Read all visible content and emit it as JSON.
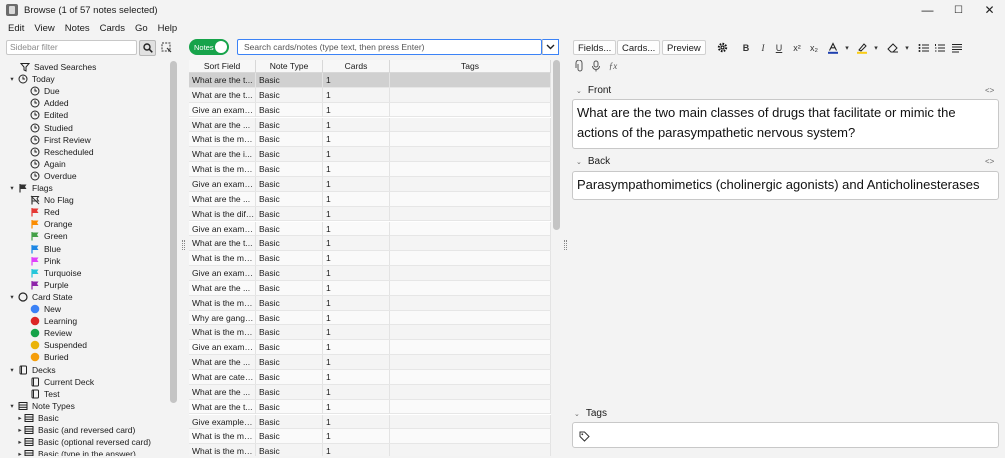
{
  "window": {
    "title": "Browse (1 of 57 notes selected)",
    "min": "—",
    "max": "☐",
    "close": "✕"
  },
  "menu": [
    "Edit",
    "View",
    "Notes",
    "Cards",
    "Go",
    "Help"
  ],
  "sidebar": {
    "filter_placeholder": "Sidebar filter",
    "items": [
      {
        "label": "Saved Searches",
        "icon": "funnel-icon",
        "level": 1,
        "arrow": ""
      },
      {
        "label": "Today",
        "icon": "clock-icon",
        "level": 1,
        "arrow": "▾"
      },
      {
        "label": "Due",
        "icon": "clock-icon",
        "level": 2,
        "arrow": ""
      },
      {
        "label": "Added",
        "icon": "clock-icon",
        "level": 2,
        "arrow": ""
      },
      {
        "label": "Edited",
        "icon": "clock-icon",
        "level": 2,
        "arrow": ""
      },
      {
        "label": "Studied",
        "icon": "clock-icon",
        "level": 2,
        "arrow": ""
      },
      {
        "label": "First Review",
        "icon": "clock-icon",
        "level": 2,
        "arrow": ""
      },
      {
        "label": "Rescheduled",
        "icon": "clock-icon",
        "level": 2,
        "arrow": ""
      },
      {
        "label": "Again",
        "icon": "clock-icon",
        "level": 2,
        "arrow": ""
      },
      {
        "label": "Overdue",
        "icon": "clock-icon",
        "level": 2,
        "arrow": ""
      },
      {
        "label": "Flags",
        "icon": "flag-icon",
        "level": 1,
        "arrow": "▾",
        "color": "#333333"
      },
      {
        "label": "No Flag",
        "icon": "no-flag-icon",
        "level": 2,
        "arrow": "",
        "color": "#333333"
      },
      {
        "label": "Red",
        "icon": "flag-icon",
        "level": 2,
        "arrow": "",
        "color": "#e53935"
      },
      {
        "label": "Orange",
        "icon": "flag-icon",
        "level": 2,
        "arrow": "",
        "color": "#fb8c00"
      },
      {
        "label": "Green",
        "icon": "flag-icon",
        "level": 2,
        "arrow": "",
        "color": "#43a047"
      },
      {
        "label": "Blue",
        "icon": "flag-icon",
        "level": 2,
        "arrow": "",
        "color": "#1e88e5"
      },
      {
        "label": "Pink",
        "icon": "flag-icon",
        "level": 2,
        "arrow": "",
        "color": "#e040fb"
      },
      {
        "label": "Turquoise",
        "icon": "flag-icon",
        "level": 2,
        "arrow": "",
        "color": "#26c6da"
      },
      {
        "label": "Purple",
        "icon": "flag-icon",
        "level": 2,
        "arrow": "",
        "color": "#8e24aa"
      },
      {
        "label": "Card State",
        "icon": "circle-outline-icon",
        "level": 1,
        "arrow": "▾"
      },
      {
        "label": "New",
        "icon": "dot-icon",
        "level": 2,
        "arrow": "",
        "color": "#3b82f6"
      },
      {
        "label": "Learning",
        "icon": "dot-icon",
        "level": 2,
        "arrow": "",
        "color": "#dc2626"
      },
      {
        "label": "Review",
        "icon": "dot-icon",
        "level": 2,
        "arrow": "",
        "color": "#16a34a"
      },
      {
        "label": "Suspended",
        "icon": "dot-icon",
        "level": 2,
        "arrow": "",
        "color": "#eab308"
      },
      {
        "label": "Buried",
        "icon": "dot-icon",
        "level": 2,
        "arrow": "",
        "color": "#f59e0b"
      },
      {
        "label": "Decks",
        "icon": "deck-icon",
        "level": 1,
        "arrow": "▾"
      },
      {
        "label": "Current Deck",
        "icon": "deck-icon",
        "level": 2,
        "arrow": ""
      },
      {
        "label": "Test",
        "icon": "deck-icon",
        "level": 2,
        "arrow": ""
      },
      {
        "label": "Note Types",
        "icon": "notetype-icon",
        "level": 1,
        "arrow": "▾"
      },
      {
        "label": "Basic",
        "icon": "notetype-icon",
        "level": 2,
        "arrow": "▸"
      },
      {
        "label": "Basic (and reversed card)",
        "icon": "notetype-icon",
        "level": 2,
        "arrow": "▸"
      },
      {
        "label": "Basic (optional reversed card)",
        "icon": "notetype-icon",
        "level": 2,
        "arrow": "▸"
      },
      {
        "label": "Basic (type in the answer)",
        "icon": "notetype-icon",
        "level": 2,
        "arrow": "▸"
      }
    ]
  },
  "search": {
    "toggle_label": "Notes",
    "placeholder": "Search cards/notes (type text, then press Enter)"
  },
  "table": {
    "columns": [
      "Sort Field",
      "Note Type",
      "Cards",
      "Tags"
    ],
    "rows": [
      [
        "What are the t...",
        "Basic",
        "1",
        ""
      ],
      [
        "What are the t...",
        "Basic",
        "1",
        ""
      ],
      [
        "Give an examp...",
        "Basic",
        "1",
        ""
      ],
      [
        "What are the ...",
        "Basic",
        "1",
        ""
      ],
      [
        "What is the me...",
        "Basic",
        "1",
        ""
      ],
      [
        "What are the i...",
        "Basic",
        "1",
        ""
      ],
      [
        "What is the me...",
        "Basic",
        "1",
        ""
      ],
      [
        "Give an examp...",
        "Basic",
        "1",
        ""
      ],
      [
        "What are the ...",
        "Basic",
        "1",
        ""
      ],
      [
        "What is the diff...",
        "Basic",
        "1",
        ""
      ],
      [
        "Give an examp...",
        "Basic",
        "1",
        ""
      ],
      [
        "What are the t...",
        "Basic",
        "1",
        ""
      ],
      [
        "What is the me...",
        "Basic",
        "1",
        ""
      ],
      [
        "Give an examp...",
        "Basic",
        "1",
        ""
      ],
      [
        "What are the ...",
        "Basic",
        "1",
        ""
      ],
      [
        "What is the me...",
        "Basic",
        "1",
        ""
      ],
      [
        "Why are gangli...",
        "Basic",
        "1",
        ""
      ],
      [
        "What is the me...",
        "Basic",
        "1",
        ""
      ],
      [
        "Give an examp...",
        "Basic",
        "1",
        ""
      ],
      [
        "What are the ...",
        "Basic",
        "1",
        ""
      ],
      [
        "What are catec...",
        "Basic",
        "1",
        ""
      ],
      [
        "What are the ...",
        "Basic",
        "1",
        ""
      ],
      [
        "What are the t...",
        "Basic",
        "1",
        ""
      ],
      [
        "Give examples...",
        "Basic",
        "1",
        ""
      ],
      [
        "What is the me...",
        "Basic",
        "1",
        ""
      ],
      [
        "What is the me...",
        "Basic",
        "1",
        ""
      ]
    ],
    "selected_index": 0
  },
  "editor": {
    "fields_button": "Fields...",
    "cards_button": "Cards...",
    "preview_button": "Preview",
    "front_label": "Front",
    "front_value": "What are the two main classes of drugs that facilitate or mimic the actions of the parasympathetic nervous system?",
    "back_label": "Back",
    "back_value": "Parasympathomimetics (cholinergic agonists) and Anticholinesterases",
    "tags_label": "Tags",
    "html_toggle": "<>"
  },
  "colors": {
    "accent": "#3b82f6",
    "toggle_on": "#16a34a",
    "text_color_swatch": "#1e40af",
    "highlight_swatch": "#facc15"
  }
}
